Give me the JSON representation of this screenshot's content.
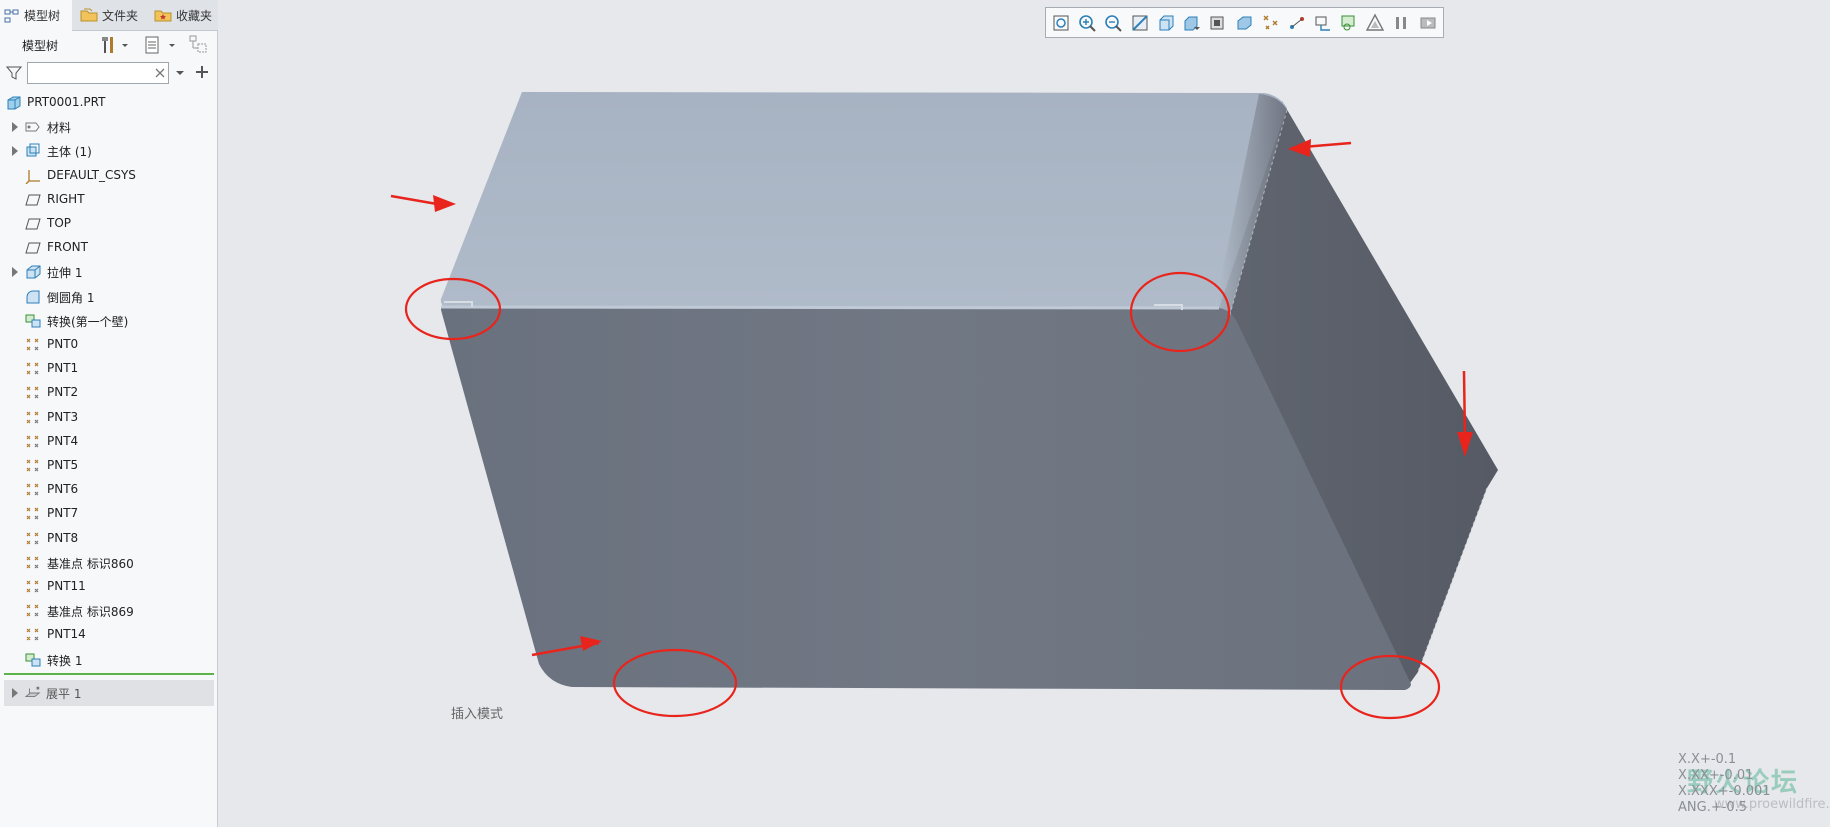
{
  "tabs": [
    {
      "label": "模型树",
      "active": true
    },
    {
      "label": "文件夹",
      "active": false
    },
    {
      "label": "收藏夹",
      "active": false
    }
  ],
  "tree_header": {
    "title": "模型树"
  },
  "search": {
    "value": "",
    "placeholder": ""
  },
  "tree": {
    "root": "PRT0001.PRT",
    "items": [
      {
        "label": "材料",
        "icon": "material-icon",
        "expandable": true
      },
      {
        "label": "主体 (1)",
        "icon": "body-icon",
        "expandable": true
      },
      {
        "label": "DEFAULT_CSYS",
        "icon": "csys-icon",
        "expandable": false
      },
      {
        "label": "RIGHT",
        "icon": "datum-plane-icon",
        "expandable": false
      },
      {
        "label": "TOP",
        "icon": "datum-plane-icon",
        "expandable": false
      },
      {
        "label": "FRONT",
        "icon": "datum-plane-icon",
        "expandable": false
      },
      {
        "label": "拉伸 1",
        "icon": "extrude-icon",
        "expandable": true
      },
      {
        "label": "倒圆角 1",
        "icon": "round-icon",
        "expandable": false
      },
      {
        "label": "转换(第一个壁)",
        "icon": "convert-icon",
        "expandable": false
      },
      {
        "label": "PNT0",
        "icon": "datum-point-icon",
        "expandable": false
      },
      {
        "label": "PNT1",
        "icon": "datum-point-icon",
        "expandable": false
      },
      {
        "label": "PNT2",
        "icon": "datum-point-icon",
        "expandable": false
      },
      {
        "label": "PNT3",
        "icon": "datum-point-icon",
        "expandable": false
      },
      {
        "label": "PNT4",
        "icon": "datum-point-icon",
        "expandable": false
      },
      {
        "label": "PNT5",
        "icon": "datum-point-icon",
        "expandable": false
      },
      {
        "label": "PNT6",
        "icon": "datum-point-icon",
        "expandable": false
      },
      {
        "label": "PNT7",
        "icon": "datum-point-icon",
        "expandable": false
      },
      {
        "label": "PNT8",
        "icon": "datum-point-icon",
        "expandable": false
      },
      {
        "label": "基准点 标识860",
        "icon": "datum-point-icon",
        "expandable": false
      },
      {
        "label": "PNT11",
        "icon": "datum-point-icon",
        "expandable": false
      },
      {
        "label": "基准点 标识869",
        "icon": "datum-point-icon",
        "expandable": false
      },
      {
        "label": "PNT14",
        "icon": "datum-point-icon",
        "expandable": false
      },
      {
        "label": "转换 1",
        "icon": "convert-icon",
        "expandable": false
      }
    ],
    "after_insert": {
      "label": "展平 1",
      "icon": "flatten-icon"
    }
  },
  "toolbar": {
    "icons": [
      "refit-icon",
      "zoom-in-icon",
      "zoom-out-icon",
      "repaint-icon",
      "display-style-icon",
      "saved-views-icon",
      "view-manager-icon",
      "perspective-icon",
      "datum-display-icon",
      "annotation-icon",
      "spin-center-icon",
      "sheetmetal-icon",
      "shading-icon",
      "pause-icon",
      "playback-icon"
    ]
  },
  "status": {
    "mode": "插入模式"
  },
  "tolerance": [
    "X.X+-0.1",
    "X.XX+-0.01",
    "X.XXX+-0.001",
    "ANG.+-0.5"
  ],
  "watermark": {
    "text": "野火论坛",
    "url": "www.proewildfire.cn"
  },
  "colors": {
    "model_top": "#aab6c6",
    "model_front": "#6f7683",
    "model_side": "#585d67",
    "annotation": "#e8241c",
    "insert_line": "#5db34a"
  }
}
